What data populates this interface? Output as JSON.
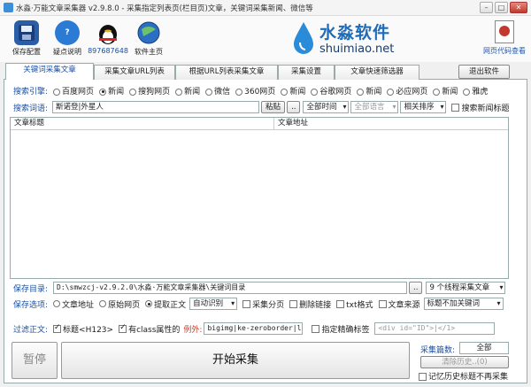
{
  "window": {
    "title": "水淼·万能文章采集器 v2.9.8.0 - 采集指定列表页(栏目页)文章，关键词采集新闻、微信等",
    "min": "–",
    "max": "□",
    "close": "✕"
  },
  "toolbar": {
    "save": "保存配置",
    "help": "疑点说明",
    "qq": "897687648",
    "home": "软件主页",
    "html_view": "网页代码查看",
    "brand_cn": "水淼软件",
    "brand_en": "shuimiao.net"
  },
  "tabs": [
    "关键词采集文章",
    "采集文章URL列表",
    "根据URL列表采集文章",
    "采集设置",
    "文章快速筛选器"
  ],
  "exit_label": "退出软件",
  "search_engine": {
    "label": "搜索引擎:",
    "options": [
      "百度网页",
      "新闻",
      "搜狗网页",
      "新闻",
      "微信",
      "360网页",
      "新闻",
      "谷歌网页",
      "新闻",
      "必应网页",
      "新闻",
      "雅虎"
    ],
    "selected_index": 1
  },
  "keyword": {
    "label": "搜索词语:",
    "value": "斯诺登|外星人",
    "paste": "粘贴",
    "more": "..",
    "time_select": "全部时间",
    "lang_select": "全部语言",
    "sort_select": "相关排序",
    "news_title_chk": "搜索新闻标题"
  },
  "grid": {
    "col_title": "文章标题",
    "col_url": "文章地址"
  },
  "save_dir": {
    "label": "保存目录:",
    "value": "D:\\smwzcj-v2.9.2.0\\水淼·万能文章采集器\\关键词目录",
    "more": "..",
    "threads": "9 个线程采集文章"
  },
  "save_opts": {
    "label": "保存选项:",
    "addr": "文章地址",
    "raw": "原始网页",
    "extract": "提取正文",
    "detect": "自动识别",
    "paging": "采集分页",
    "del_links": "删除链接",
    "txt": "txt格式",
    "source": "文章来源",
    "title_kw": "标题不加关键词"
  },
  "filter": {
    "label": "过滤正文:",
    "title_chk": "标题<H123>",
    "class_chk": "有class属性的",
    "except": "例外:",
    "except_value": "bigimg|ke-zeroborder|lin",
    "precise_chk": "指定精确标签",
    "precise_placeholder": "<div id=\"ID\">|</1>"
  },
  "actions": {
    "pause": "暂停",
    "start": "开始采集",
    "count_label": "采集篇数:",
    "count_value": "全部",
    "clear_history": "清除历史..(0)",
    "remember_history": "记忆历史标题不再采集"
  },
  "colors": {
    "accent": "#1a4fa0",
    "brand": "#1e6bb8",
    "except": "#c0392b"
  }
}
